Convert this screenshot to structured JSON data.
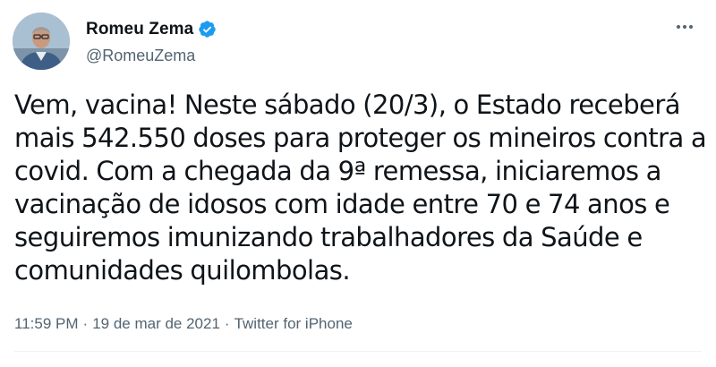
{
  "tweet": {
    "author": {
      "display_name": "Romeu Zema",
      "handle": "@RomeuZema",
      "verified": true
    },
    "text_lines": [
      "Vem, vacina! Neste sábado (20/3), o Estado receberá",
      "mais 542.550 doses para proteger os mineiros contra a",
      "covid. Com a chegada da 9ª remessa, iniciaremos a",
      "vacinação de idosos com idade entre 70 e 74 anos e",
      "seguiremos imunizando trabalhadores da Saúde e",
      "comunidades quilombolas."
    ],
    "meta": {
      "time": "11:59 PM",
      "separator": "·",
      "date": "19 de mar de 2021",
      "source": "Twitter for iPhone"
    }
  },
  "colors": {
    "verified_badge": "#1d9bf0",
    "secondary_text": "#536471",
    "primary_text": "#0f1419"
  },
  "icons": {
    "verified": "verified-badge-icon",
    "more": "more-options-icon"
  }
}
